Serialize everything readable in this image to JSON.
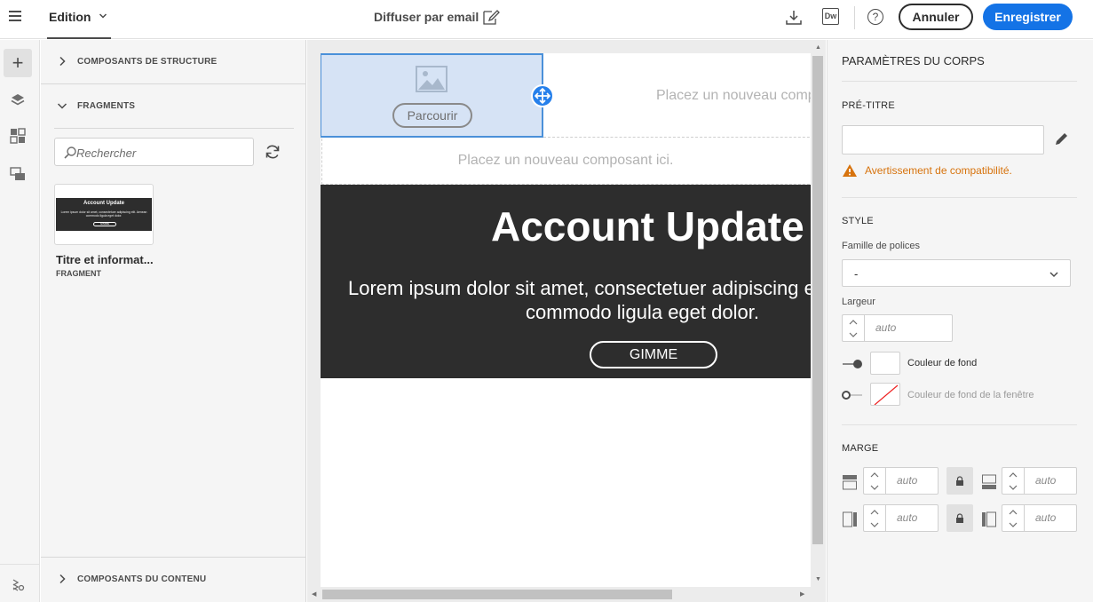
{
  "topbar": {
    "mode_label": "Edition",
    "document_title": "Diffuser par email",
    "dw_label": "Dw",
    "help_label": "?",
    "cancel_label": "Annuler",
    "save_label": "Enregistrer"
  },
  "components_panel": {
    "structure_title": "COMPOSANTS DE STRUCTURE",
    "fragments_title": "FRAGMENTS",
    "search_placeholder": "Rechercher",
    "content_title": "COMPOSANTS DU CONTENU",
    "fragments": [
      {
        "name": "Titre et informat...",
        "type": "FRAGMENT",
        "thumb_title": "Account Update",
        "thumb_text": "Lorem ipsum dolor sit amet, consectetuer adipiscing elit. Aenean commodo ligula eget dolor.",
        "thumb_button": "GIMME"
      }
    ]
  },
  "canvas": {
    "browse_label": "Parcourir",
    "drop_right": "Placez un nouveau composant ici.",
    "drop_row": "Placez un nouveau composant ici.",
    "dark_title": "Account Update",
    "dark_text_line1": "Lorem ipsum dolor sit amet, consectetuer adipiscing elit. Aenean",
    "dark_text_line2": "commodo ligula eget dolor.",
    "button_label": "GIMME"
  },
  "properties": {
    "header": "PARAMÈTRES DU CORPS",
    "pretitle_label": "PRÉ-TITRE",
    "pretitle_value": "",
    "warning_text": "Avertissement de compatibilité.",
    "style_label": "STYLE",
    "font_family_label": "Famille de polices",
    "font_family_value": "-",
    "width_label": "Largeur",
    "width_value": "auto",
    "bg_color_label": "Couleur de fond",
    "window_bg_label": "Couleur de fond de la fenêtre",
    "margin_label": "MARGE",
    "margin_top": "auto",
    "margin_bottom": "auto",
    "margin_left": "auto",
    "margin_right": "auto"
  },
  "colors": {
    "accent": "#1473e6",
    "warning": "#d7730d",
    "email_dark_bg": "#2d2d2d"
  }
}
